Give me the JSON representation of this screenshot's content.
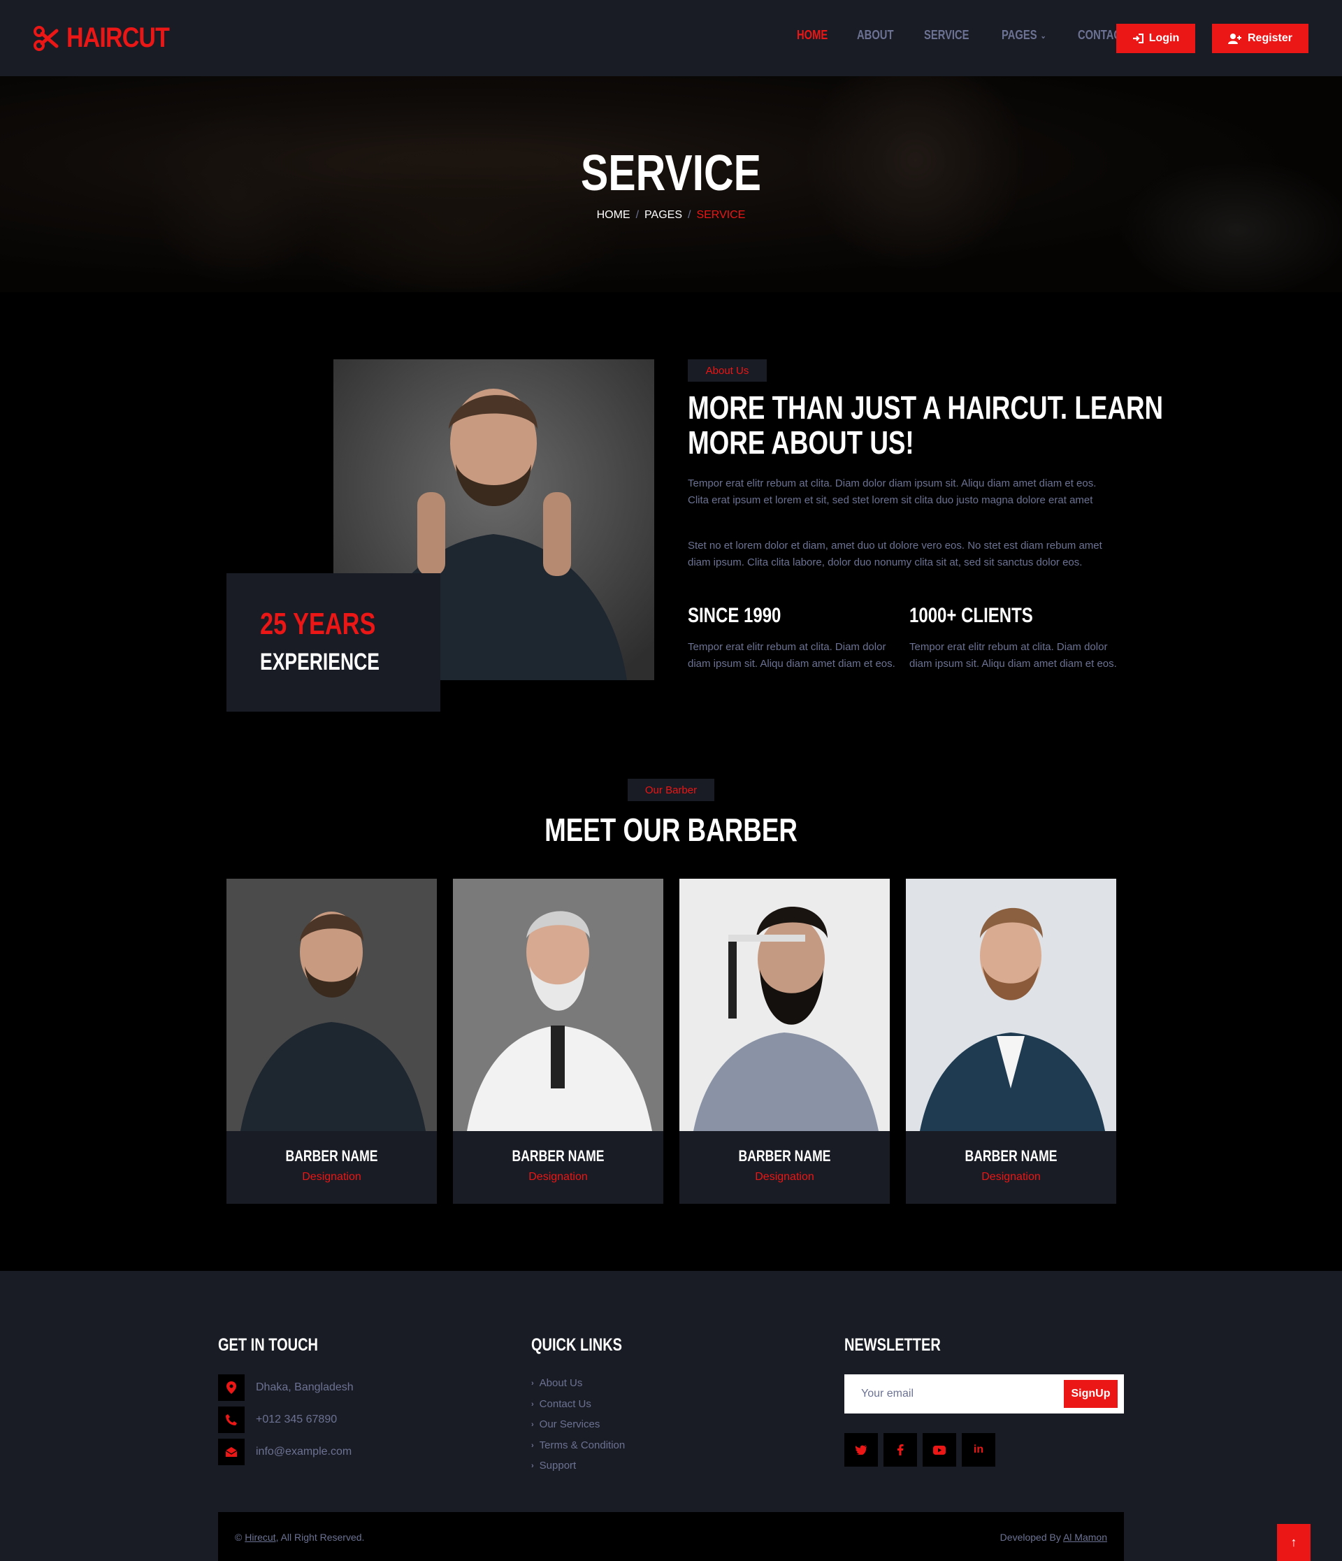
{
  "brand": {
    "name": "HAIRCUT",
    "icon": "scissors-icon"
  },
  "nav": {
    "items": [
      "HOME",
      "ABOUT",
      "SERVICE",
      "PAGES",
      "CONTACT"
    ],
    "active": "HOME",
    "login": "Login",
    "register": "Register"
  },
  "hero": {
    "title": "SERVICE",
    "breadcrumb": [
      "HOME",
      "PAGES",
      "SERVICE"
    ]
  },
  "experience": {
    "years": "25 YEARS",
    "label": "EXPERIENCE"
  },
  "about": {
    "tag": "About Us",
    "title_line1": "MORE THAN JUST A HAIRCUT. LEARN",
    "title_line2": "MORE ABOUT US!",
    "p1": "Tempor erat elitr rebum at clita. Diam dolor diam ipsum sit. Aliqu diam amet diam et eos. Clita erat ipsum et lorem et sit, sed stet lorem sit clita duo justo magna dolore erat amet",
    "p2": "Stet no et lorem dolor et diam, amet duo ut dolore vero eos. No stet est diam rebum amet diam ipsum. Clita clita labore, dolor duo nonumy clita sit at, sed sit sanctus dolor eos.",
    "stats": [
      {
        "title": "SINCE 1990",
        "text": "Tempor erat elitr rebum at clita. Diam dolor diam ipsum sit. Aliqu diam amet diam et eos."
      },
      {
        "title": "1000+ CLIENTS",
        "text": "Tempor erat elitr rebum at clita. Diam dolor diam ipsum sit. Aliqu diam amet diam et eos."
      }
    ]
  },
  "barbers": {
    "tag": "Our Barber",
    "heading": "MEET OUR BARBER",
    "cards": [
      {
        "name": "BARBER NAME",
        "designation": "Designation"
      },
      {
        "name": "BARBER NAME",
        "designation": "Designation"
      },
      {
        "name": "BARBER NAME",
        "designation": "Designation"
      },
      {
        "name": "BARBER NAME",
        "designation": "Designation"
      }
    ]
  },
  "footer": {
    "touch_heading": "GET IN TOUCH",
    "address": "Dhaka, Bangladesh",
    "phone": "+012 345 67890",
    "email": "info@example.com",
    "links_heading": "QUICK LINKS",
    "links": [
      "About Us",
      "Contact Us",
      "Our Services",
      "Terms & Condition",
      "Support"
    ],
    "newsletter_heading": "NEWSLETTER",
    "email_placeholder": "Your email",
    "signup": "SignUp",
    "social": [
      "twitter-icon",
      "facebook-icon",
      "youtube-icon",
      "linkedin-icon"
    ],
    "copyright_prefix": "© ",
    "copyright_link": "Hirecut",
    "copyright_suffix": ", All Right Reserved.",
    "developed_prefix": "Developed By ",
    "developed_link": "Al Mamon"
  },
  "colors": {
    "accent": "#eb1616",
    "panel": "#191c24",
    "muted": "#6c7293",
    "background": "#000000"
  }
}
